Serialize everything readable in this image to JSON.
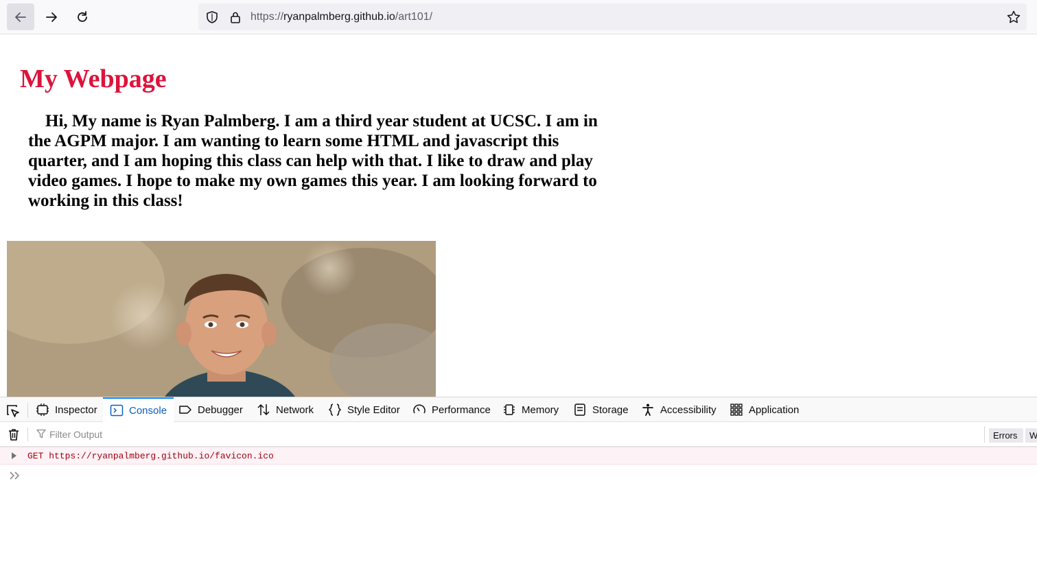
{
  "browser": {
    "url": {
      "scheme": "https://",
      "host": "ryanpalmberg.github.io",
      "path": "/art101/"
    },
    "icons": [
      "back-arrow-icon",
      "forward-arrow-icon",
      "reload-icon",
      "shield-icon",
      "lock-icon",
      "bookmark-star-icon"
    ]
  },
  "page": {
    "title": "My Webpage",
    "intro": "Hi, My name is Ryan Palmberg. I am a third year student at UCSC. I am in the AGPM major. I am wanting to learn some HTML and javascript this quarter, and I am hoping this class can help with that. I like to draw and play video games. I hope to make my own games this year. I am looking forward to working in this class!",
    "title_color": "#dc143c"
  },
  "devtools": {
    "tabs": [
      {
        "label": "Inspector",
        "icon": "inspector-icon"
      },
      {
        "label": "Console",
        "icon": "console-icon",
        "active": true
      },
      {
        "label": "Debugger",
        "icon": "debugger-icon"
      },
      {
        "label": "Network",
        "icon": "network-icon"
      },
      {
        "label": "Style Editor",
        "icon": "style-editor-icon"
      },
      {
        "label": "Performance",
        "icon": "performance-icon"
      },
      {
        "label": "Memory",
        "icon": "memory-icon"
      },
      {
        "label": "Storage",
        "icon": "storage-icon"
      },
      {
        "label": "Accessibility",
        "icon": "accessibility-icon"
      },
      {
        "label": "Application",
        "icon": "application-icon"
      }
    ],
    "filter_placeholder": "Filter Output",
    "filter_buttons": {
      "errors": "Errors",
      "warnings": "W"
    },
    "console_message": "GET https://ryanpalmberg.github.io/favicon.ico",
    "accent_color": "#0a84ff",
    "error_color": "#a4000f"
  }
}
